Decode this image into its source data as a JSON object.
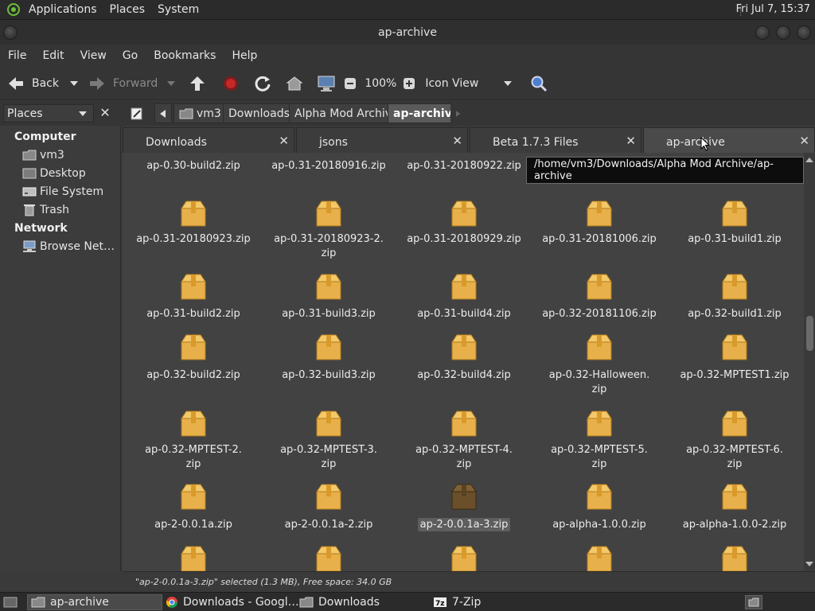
{
  "panel": {
    "menus": [
      "Applications",
      "Places",
      "System"
    ],
    "clock": "Fri Jul 7, 15:37"
  },
  "window": {
    "title": "ap-archive"
  },
  "menubar": [
    "File",
    "Edit",
    "View",
    "Go",
    "Bookmarks",
    "Help"
  ],
  "toolbar": {
    "back": "Back",
    "forward": "Forward",
    "zoom": "100%",
    "view_mode": "Icon View"
  },
  "location": {
    "places_label": "Places",
    "crumbs": [
      "vm3",
      "Downloads",
      "Alpha Mod Archive",
      "ap-archive"
    ]
  },
  "sidebar": {
    "computer_heading": "Computer",
    "computer_items": [
      "vm3",
      "Desktop",
      "File System",
      "Trash"
    ],
    "network_heading": "Network",
    "network_items": [
      "Browse Net…"
    ]
  },
  "tabs": [
    "Downloads",
    "jsons",
    "Beta 1.7.3 Files",
    "ap-archive"
  ],
  "tooltip": "/home/vm3/Downloads/Alpha Mod Archive/ap-archive",
  "files": [
    [
      "ap-0.30-build2.zip",
      "ap-0.31-20180916.zip",
      "ap-0.31-20180922.zip",
      "",
      ""
    ],
    [
      "ap-0.31-20180923.zip",
      "ap-0.31-20180923-2.\nzip",
      "ap-0.31-20180929.zip",
      "ap-0.31-20181006.zip",
      "ap-0.31-build1.zip"
    ],
    [
      "ap-0.31-build2.zip",
      "ap-0.31-build3.zip",
      "ap-0.31-build4.zip",
      "ap-0.32-20181106.zip",
      "ap-0.32-build1.zip"
    ],
    [
      "ap-0.32-build2.zip",
      "ap-0.32-build3.zip",
      "ap-0.32-build4.zip",
      "ap-0.32-Halloween.\nzip",
      "ap-0.32-MPTEST1.zip"
    ],
    [
      "ap-0.32-MPTEST-2.\nzip",
      "ap-0.32-MPTEST-3.\nzip",
      "ap-0.32-MPTEST-4.\nzip",
      "ap-0.32-MPTEST-5.\nzip",
      "ap-0.32-MPTEST-6.\nzip"
    ],
    [
      "ap-2-0.0.1a.zip",
      "ap-2-0.0.1a-2.zip",
      "ap-2-0.0.1a-3.zip",
      "ap-alpha-1.0.0.zip",
      "ap-alpha-1.0.0-2.zip"
    ],
    [
      "",
      "",
      "",
      "",
      ""
    ]
  ],
  "selected_file": "ap-2-0.0.1a-3.zip",
  "status": "\"ap-2-0.0.1a-3.zip\" selected (1.3 MB), Free space: 34.0 GB",
  "taskbar": [
    "ap-archive",
    "Downloads - Googl…",
    "Downloads",
    "7-Zip"
  ],
  "colors": {
    "folder_icon": "#e8b04a",
    "selected_icon": "#6b4f2a",
    "panel": "#2b2b2b"
  }
}
